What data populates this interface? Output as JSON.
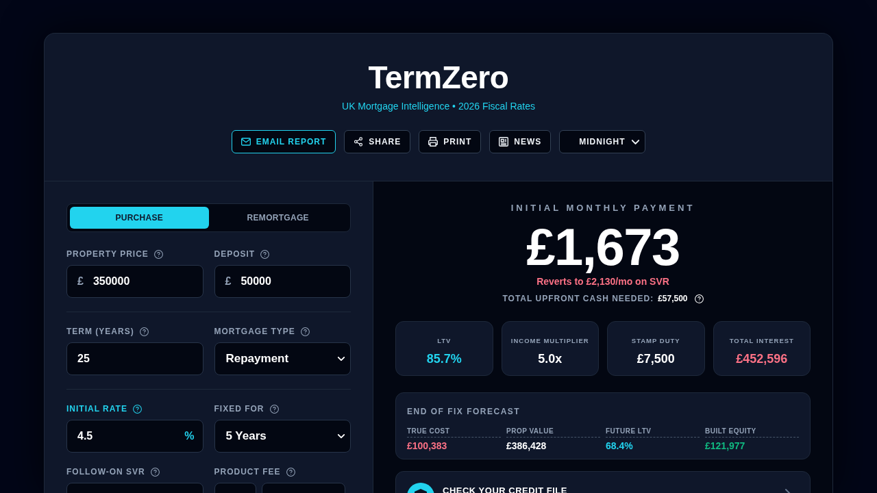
{
  "header": {
    "title": "TermZero",
    "subtitle": "UK Mortgage Intelligence • 2026 Fiscal Rates",
    "actions": [
      {
        "kind": "email",
        "label": "EMAIL REPORT",
        "primary": true
      },
      {
        "kind": "share",
        "label": "SHARE",
        "primary": false
      },
      {
        "kind": "print",
        "label": "PRINT",
        "primary": false
      },
      {
        "kind": "news",
        "label": "NEWS",
        "primary": false
      }
    ],
    "theme_select": {
      "value": "MIDNIGHT"
    }
  },
  "mode_tabs": [
    {
      "label": "PURCHASE",
      "selected": true
    },
    {
      "label": "REMORTGAGE",
      "selected": false
    }
  ],
  "sections": [
    {
      "fields": [
        {
          "label": "PROPERTY PRICE",
          "kind": "input",
          "prefix": "£",
          "value": "350000",
          "highlighted": false
        },
        {
          "label": "DEPOSIT",
          "kind": "input",
          "prefix": "£",
          "value": "50000",
          "highlighted": false
        }
      ]
    },
    {
      "fields": [
        {
          "label": "TERM (YEARS)",
          "kind": "input",
          "value": "25",
          "highlighted": false
        },
        {
          "label": "MORTGAGE TYPE",
          "kind": "select",
          "value": "Repayment",
          "highlighted": false
        }
      ]
    },
    {
      "fields": [
        {
          "label": "INITIAL RATE",
          "kind": "input",
          "value": "4.5",
          "suffix": "%",
          "highlighted": true
        },
        {
          "label": "FIXED FOR",
          "kind": "select",
          "value": "5 Years",
          "highlighted": false
        },
        {
          "label": "FOLLOW-ON SVR",
          "kind": "input",
          "highlighted": false
        },
        {
          "label": "PRODUCT FEE",
          "kind": "split",
          "highlighted": false
        }
      ]
    }
  ],
  "payment": {
    "caption": "INITIAL MONTHLY PAYMENT",
    "amount": "£1,673",
    "revert_note": "Reverts to £2,130/mo on SVR",
    "upfront_label": "TOTAL UPFRONT CASH NEEDED:",
    "upfront_value": "£57,500"
  },
  "stats": [
    {
      "label": "LTV",
      "value": "85.7%",
      "color": "#22d3ee"
    },
    {
      "label": "INCOME MULTIPLIER",
      "value": "5.0x",
      "color": "#ffffff"
    },
    {
      "label": "STAMP DUTY",
      "value": "£7,500",
      "color": "#ffffff"
    },
    {
      "label": "TOTAL INTEREST",
      "value": "£452,596",
      "color": "#fb7185"
    }
  ],
  "forecast": {
    "title": "END OF FIX FORECAST",
    "items": [
      {
        "label": "TRUE COST",
        "value": "£100,383",
        "color": "#fb7185"
      },
      {
        "label": "PROP VALUE",
        "value": "£386,428",
        "color": "#ffffff"
      },
      {
        "label": "FUTURE LTV",
        "value": "68.4%",
        "color": "#22d3ee"
      },
      {
        "label": "BUILT EQUITY",
        "value": "£121,977",
        "color": "#10b981"
      }
    ]
  },
  "credit_banner": {
    "title": "CHECK YOUR CREDIT FILE"
  }
}
